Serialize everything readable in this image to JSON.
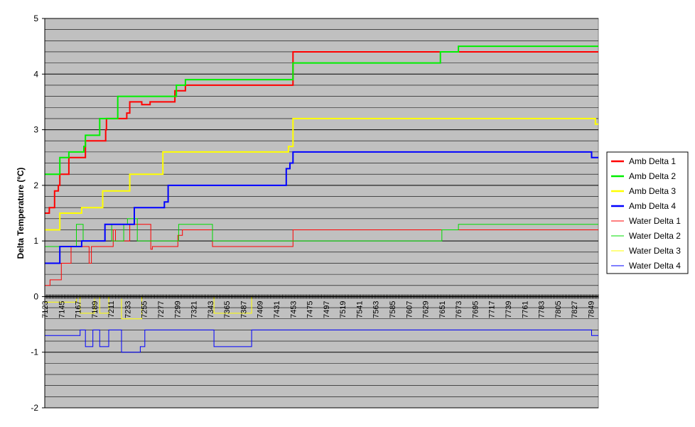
{
  "chart_data": {
    "type": "line",
    "title": "",
    "xlabel": "",
    "ylabel": "Delta Temperature (ºC)",
    "ylim": [
      -2,
      5
    ],
    "xlim": [
      7123,
      7859
    ],
    "y_ticks": [
      -2,
      -1,
      0,
      1,
      2,
      3,
      4,
      5
    ],
    "y_minor_step": 0.2,
    "x_tick_labels": [
      "7123",
      "7145",
      "7167",
      "7189",
      "7211",
      "7233",
      "7255",
      "7277",
      "7299",
      "7321",
      "7343",
      "7365",
      "7387",
      "7409",
      "7431",
      "7453",
      "7475",
      "7497",
      "7519",
      "7541",
      "7563",
      "7585",
      "7607",
      "7629",
      "7651",
      "7673",
      "7695",
      "7717",
      "7739",
      "7761",
      "7783",
      "7805",
      "7827",
      "7849"
    ],
    "grid": true,
    "plot_background": "#c0c0c0",
    "legend_position": "right",
    "series": [
      {
        "name": "Amb Delta 1",
        "color": "#ff0000",
        "width": 2,
        "points": [
          [
            7123,
            1.5
          ],
          [
            7129,
            1.5
          ],
          [
            7129,
            1.6
          ],
          [
            7136,
            1.6
          ],
          [
            7136,
            1.9
          ],
          [
            7141,
            1.9
          ],
          [
            7141,
            2.0
          ],
          [
            7143,
            2.0
          ],
          [
            7143,
            2.2
          ],
          [
            7155,
            2.2
          ],
          [
            7155,
            2.5
          ],
          [
            7177,
            2.5
          ],
          [
            7177,
            2.8
          ],
          [
            7204,
            2.8
          ],
          [
            7204,
            3.0
          ],
          [
            7205,
            3.0
          ],
          [
            7205,
            3.2
          ],
          [
            7232,
            3.2
          ],
          [
            7232,
            3.3
          ],
          [
            7236,
            3.3
          ],
          [
            7236,
            3.5
          ],
          [
            7252,
            3.5
          ],
          [
            7252,
            3.45
          ],
          [
            7263,
            3.45
          ],
          [
            7263,
            3.5
          ],
          [
            7296,
            3.5
          ],
          [
            7296,
            3.7
          ],
          [
            7310,
            3.7
          ],
          [
            7310,
            3.8
          ],
          [
            7340,
            3.8
          ],
          [
            7453,
            3.8
          ],
          [
            7453,
            4.4
          ],
          [
            7859,
            4.4
          ]
        ]
      },
      {
        "name": "Amb Delta 2",
        "color": "#00ee00",
        "width": 2,
        "points": [
          [
            7123,
            2.2
          ],
          [
            7143,
            2.2
          ],
          [
            7143,
            2.5
          ],
          [
            7155,
            2.5
          ],
          [
            7155,
            2.6
          ],
          [
            7175,
            2.6
          ],
          [
            7175,
            2.7
          ],
          [
            7177,
            2.7
          ],
          [
            7177,
            2.9
          ],
          [
            7196,
            2.9
          ],
          [
            7196,
            3.2
          ],
          [
            7220,
            3.2
          ],
          [
            7220,
            3.6
          ],
          [
            7298,
            3.6
          ],
          [
            7298,
            3.8
          ],
          [
            7310,
            3.8
          ],
          [
            7310,
            3.9
          ],
          [
            7453,
            3.9
          ],
          [
            7453,
            4.2
          ],
          [
            7649,
            4.2
          ],
          [
            7649,
            4.4
          ],
          [
            7673,
            4.4
          ],
          [
            7673,
            4.5
          ],
          [
            7859,
            4.5
          ]
        ]
      },
      {
        "name": "Amb Delta 3",
        "color": "#ffff00",
        "width": 2,
        "points": [
          [
            7123,
            1.2
          ],
          [
            7143,
            1.2
          ],
          [
            7143,
            1.5
          ],
          [
            7172,
            1.5
          ],
          [
            7172,
            1.6
          ],
          [
            7200,
            1.6
          ],
          [
            7200,
            1.9
          ],
          [
            7236,
            1.9
          ],
          [
            7236,
            2.2
          ],
          [
            7280,
            2.2
          ],
          [
            7280,
            2.6
          ],
          [
            7447,
            2.6
          ],
          [
            7447,
            2.7
          ],
          [
            7453,
            2.7
          ],
          [
            7453,
            3.2
          ],
          [
            7855,
            3.2
          ],
          [
            7855,
            3.1
          ],
          [
            7859,
            3.1
          ]
        ]
      },
      {
        "name": "Amb Delta 4",
        "color": "#0000ff",
        "width": 2,
        "points": [
          [
            7123,
            0.6
          ],
          [
            7143,
            0.6
          ],
          [
            7143,
            0.9
          ],
          [
            7172,
            0.9
          ],
          [
            7172,
            1.0
          ],
          [
            7203,
            1.0
          ],
          [
            7203,
            1.3
          ],
          [
            7242,
            1.3
          ],
          [
            7242,
            1.6
          ],
          [
            7282,
            1.6
          ],
          [
            7282,
            1.7
          ],
          [
            7287,
            1.7
          ],
          [
            7287,
            2.0
          ],
          [
            7444,
            2.0
          ],
          [
            7444,
            2.3
          ],
          [
            7449,
            2.3
          ],
          [
            7449,
            2.4
          ],
          [
            7453,
            2.4
          ],
          [
            7453,
            2.6
          ],
          [
            7850,
            2.6
          ],
          [
            7850,
            2.5
          ],
          [
            7859,
            2.5
          ]
        ]
      },
      {
        "name": "Water Delta 1",
        "color": "#ff0000",
        "width": 1,
        "points": [
          [
            7123,
            0.2
          ],
          [
            7130,
            0.2
          ],
          [
            7130,
            0.3
          ],
          [
            7145,
            0.3
          ],
          [
            7145,
            0.6
          ],
          [
            7158,
            0.6
          ],
          [
            7158,
            0.9
          ],
          [
            7182,
            0.9
          ],
          [
            7182,
            0.6
          ],
          [
            7185,
            0.6
          ],
          [
            7185,
            0.9
          ],
          [
            7214,
            0.9
          ],
          [
            7214,
            1.2
          ],
          [
            7217,
            1.2
          ],
          [
            7217,
            1.0
          ],
          [
            7236,
            1.0
          ],
          [
            7236,
            1.3
          ],
          [
            7264,
            1.3
          ],
          [
            7264,
            0.85
          ],
          [
            7266,
            0.85
          ],
          [
            7266,
            0.9
          ],
          [
            7300,
            0.9
          ],
          [
            7300,
            1.1
          ],
          [
            7306,
            1.1
          ],
          [
            7306,
            1.2
          ],
          [
            7346,
            1.2
          ],
          [
            7346,
            0.9
          ],
          [
            7453,
            0.9
          ],
          [
            7453,
            1.2
          ],
          [
            7859,
            1.2
          ]
        ]
      },
      {
        "name": "Water Delta 2",
        "color": "#00dd00",
        "width": 1,
        "points": [
          [
            7123,
            0.9
          ],
          [
            7165,
            0.9
          ],
          [
            7165,
            1.3
          ],
          [
            7174,
            1.3
          ],
          [
            7174,
            1.0
          ],
          [
            7203,
            1.0
          ],
          [
            7203,
            1.3
          ],
          [
            7212,
            1.3
          ],
          [
            7212,
            1.0
          ],
          [
            7228,
            1.0
          ],
          [
            7228,
            1.3
          ],
          [
            7233,
            1.3
          ],
          [
            7233,
            1.4
          ],
          [
            7246,
            1.4
          ],
          [
            7246,
            1.0
          ],
          [
            7301,
            1.0
          ],
          [
            7301,
            1.3
          ],
          [
            7346,
            1.3
          ],
          [
            7346,
            1.0
          ],
          [
            7651,
            1.0
          ],
          [
            7651,
            1.2
          ],
          [
            7673,
            1.2
          ],
          [
            7673,
            1.3
          ],
          [
            7859,
            1.3
          ]
        ]
      },
      {
        "name": "Water Delta 3",
        "color": "#ffff00",
        "width": 1,
        "points": [
          [
            7123,
            -0.1
          ],
          [
            7165,
            -0.1
          ],
          [
            7165,
            0.0
          ],
          [
            7170,
            0.0
          ],
          [
            7170,
            -0.3
          ],
          [
            7189,
            -0.3
          ],
          [
            7189,
            0.0
          ],
          [
            7196,
            0.0
          ],
          [
            7196,
            -0.3
          ],
          [
            7208,
            -0.3
          ],
          [
            7208,
            0.0
          ],
          [
            7225,
            0.0
          ],
          [
            7225,
            -0.4
          ],
          [
            7252,
            -0.4
          ],
          [
            7252,
            0.0
          ],
          [
            7348,
            0.0
          ],
          [
            7348,
            -0.3
          ],
          [
            7398,
            -0.3
          ],
          [
            7398,
            0.0
          ],
          [
            7859,
            0.0
          ]
        ]
      },
      {
        "name": "Water Delta 4",
        "color": "#0000ff",
        "width": 1,
        "points": [
          [
            7123,
            -0.7
          ],
          [
            7170,
            -0.7
          ],
          [
            7170,
            -0.6
          ],
          [
            7177,
            -0.6
          ],
          [
            7177,
            -0.9
          ],
          [
            7187,
            -0.9
          ],
          [
            7187,
            -0.6
          ],
          [
            7196,
            -0.6
          ],
          [
            7196,
            -0.9
          ],
          [
            7208,
            -0.9
          ],
          [
            7208,
            -0.6
          ],
          [
            7225,
            -0.6
          ],
          [
            7225,
            -1.0
          ],
          [
            7250,
            -1.0
          ],
          [
            7250,
            -0.9
          ],
          [
            7256,
            -0.9
          ],
          [
            7256,
            -0.6
          ],
          [
            7348,
            -0.6
          ],
          [
            7348,
            -0.9
          ],
          [
            7398,
            -0.9
          ],
          [
            7398,
            -0.6
          ],
          [
            7850,
            -0.6
          ],
          [
            7850,
            -0.7
          ],
          [
            7859,
            -0.7
          ]
        ]
      }
    ]
  }
}
